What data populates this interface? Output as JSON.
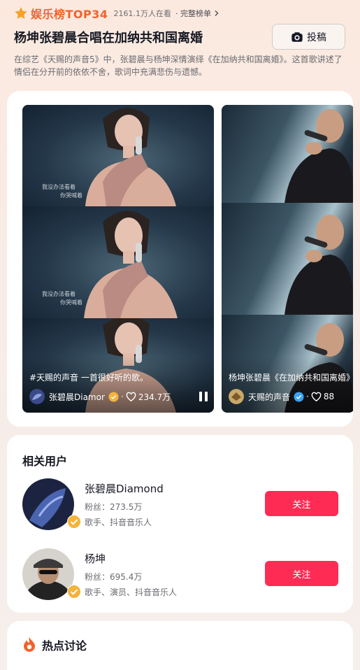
{
  "header": {
    "brand": "娱乐榜TOP34",
    "viewers": "2161.1万人在看",
    "full_list": "· 完整榜单",
    "title": "杨坤张碧晨合唱在加纳共和国离婚",
    "post_button": "投稿",
    "description": "在综艺《天赐的声音5》中，张碧晨与杨坤深情演绎《在加纳共和国离婚》。这首歌讲述了情侣在分开前的依依不舍，歌词中充满悲伤与遗憾。"
  },
  "videos": [
    {
      "caption": "#天赐的声音 一首很好听的歌。",
      "author": "张碧晨Diamond",
      "likes": "234.7万",
      "lyrics": [
        "我没办法看着",
        "你哭喊着"
      ]
    },
    {
      "caption": "杨坤张碧晨《在加纳共和国离婚》",
      "author": "天赐的声音",
      "likes": "88"
    }
  ],
  "related_users": {
    "title": "相关用户",
    "users": [
      {
        "name": "张碧晨Diamond",
        "fans_label": "粉丝：",
        "fans": "273.5万",
        "tags": "歌手、抖音音乐人",
        "follow": "关注"
      },
      {
        "name": "杨坤",
        "fans_label": "粉丝：",
        "fans": "695.4万",
        "tags": "歌手、演员、抖音音乐人",
        "follow": "关注"
      }
    ]
  },
  "hot": {
    "title": "热点讨论"
  },
  "colors": {
    "brand": "#f2622c",
    "follow": "#fe2c55",
    "verified": "#f4b33a"
  }
}
